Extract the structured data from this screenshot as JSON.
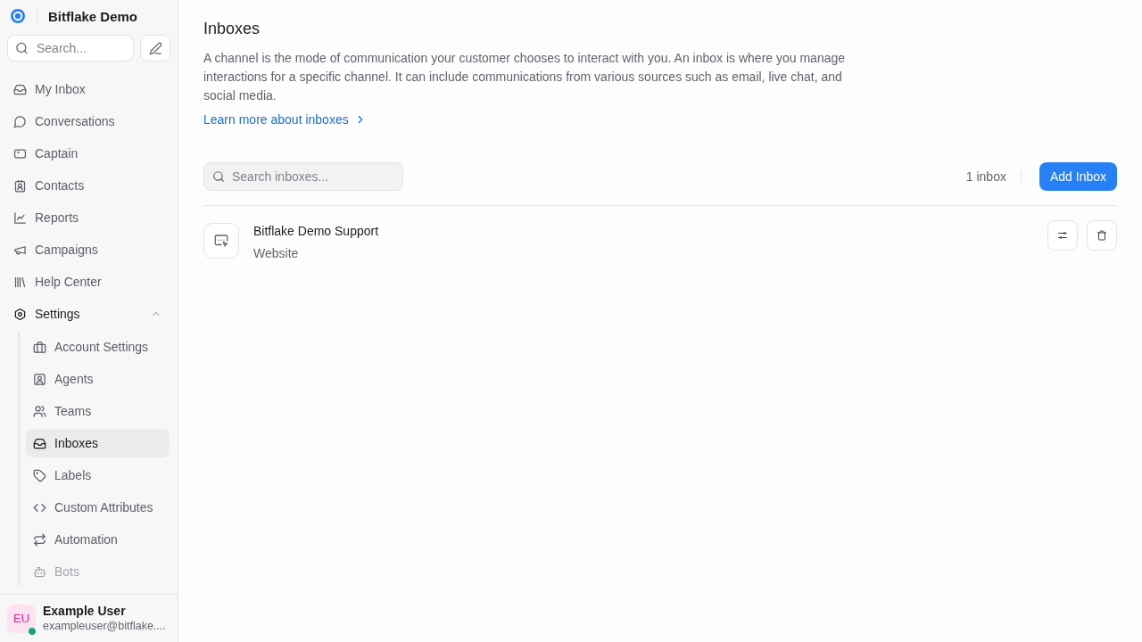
{
  "sidebar": {
    "account": {
      "name": "Bitflake Demo"
    },
    "search": {
      "placeholder": "Search..."
    },
    "nav": [
      {
        "label": "My Inbox",
        "selected": false
      },
      {
        "label": "Conversations",
        "selected": false
      },
      {
        "label": "Captain",
        "selected": false
      },
      {
        "label": "Contacts",
        "selected": false
      },
      {
        "label": "Reports",
        "selected": false
      },
      {
        "label": "Campaigns",
        "selected": false
      },
      {
        "label": "Help Center",
        "selected": false
      },
      {
        "label": "Settings",
        "selected": false,
        "expanded": true,
        "children": [
          {
            "label": "Account Settings",
            "selected": false
          },
          {
            "label": "Agents",
            "selected": false
          },
          {
            "label": "Teams",
            "selected": false
          },
          {
            "label": "Inboxes",
            "selected": true
          },
          {
            "label": "Labels",
            "selected": false
          },
          {
            "label": "Custom Attributes",
            "selected": false
          },
          {
            "label": "Automation",
            "selected": false
          },
          {
            "label": "Bots",
            "selected": false
          }
        ]
      }
    ],
    "user": {
      "initials": "EU",
      "name": "Example User",
      "email": "exampleuser@bitflake....",
      "online": true
    }
  },
  "page": {
    "title": "Inboxes",
    "description": "A channel is the mode of communication your customer chooses to interact with you. An inbox is where you manage interactions for a specific channel. It can include communications from various sources such as email, live chat, and social media.",
    "learn_more": "Learn more about inboxes"
  },
  "toolbar": {
    "search": {
      "placeholder": "Search inboxes..."
    },
    "count": "1 inbox",
    "add_button": "Add Inbox"
  },
  "inboxes": [
    {
      "name": "Bitflake Demo Support",
      "channel": "Website"
    }
  ]
}
